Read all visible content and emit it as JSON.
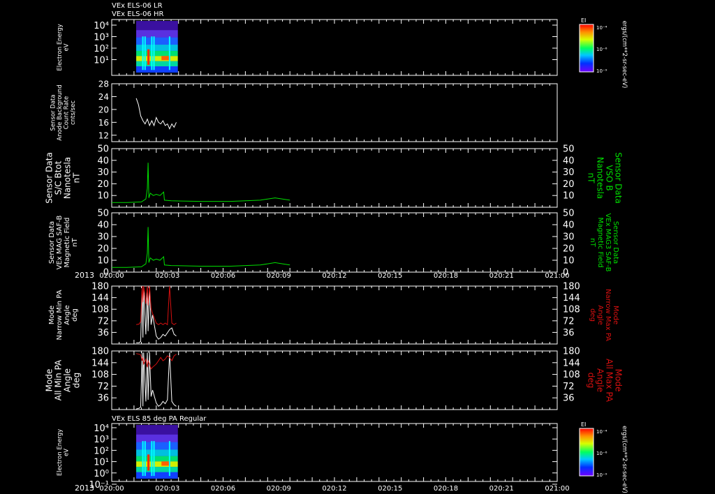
{
  "header": {
    "line1": "VEx ELS-06 LR",
    "line2": "VEx ELS-06 HR"
  },
  "time_axis": {
    "year": "2013",
    "tick_labels": [
      "020:00",
      "020:03",
      "020:06",
      "020:09",
      "020:12",
      "020:15",
      "020:18",
      "020:21",
      "021:00"
    ],
    "range_min": [
      0,
      64
    ]
  },
  "colors": {
    "white": "#ffffff",
    "green": "#00e000",
    "red": "#d81010",
    "background": "#000000"
  },
  "colorbar_units": "ergs/(cm**2-sr-sec-eV)",
  "chart_data": [
    {
      "id": "p1",
      "type": "heatmap",
      "ylabel": [
        "Electron Energy",
        "eV"
      ],
      "yscale": "log",
      "ytick_labels": [
        "10⁴",
        "10³",
        "10²",
        "10¹"
      ],
      "colorbar": {
        "label": "EI",
        "ticks": [
          "10⁻⁴",
          "10⁻⁶",
          "10⁻⁹"
        ]
      },
      "data_coverage_min": [
        3.3,
        8.9
      ]
    },
    {
      "id": "p2",
      "type": "line",
      "ylabel": [
        "Sensor Data",
        "Anode Background",
        "Count Rate",
        "cnts/sec"
      ],
      "ylim": [
        10,
        28
      ],
      "yticks": [
        12,
        16,
        20,
        24,
        28
      ],
      "series": [
        {
          "color": "#ffffff",
          "x": [
            3.3,
            3.6,
            3.9,
            4.2,
            4.5,
            4.8,
            5.1,
            5.4,
            5.7,
            6.0,
            6.3,
            6.6,
            6.9,
            7.2,
            7.5,
            7.8,
            8.1,
            8.4,
            8.7
          ],
          "values": [
            23.5,
            21.5,
            18,
            16.5,
            15.5,
            17,
            15,
            16.5,
            15,
            17.5,
            16,
            15.5,
            16.5,
            15,
            15.5,
            14,
            15.5,
            14.5,
            16
          ]
        }
      ]
    },
    {
      "id": "p3",
      "type": "line",
      "ylabel": [
        "Sensor Data",
        "S/C Btot",
        "Nanotesla",
        "nT"
      ],
      "right_label": [
        "Sensor Data",
        "VSO B",
        "Nanotesla",
        "nT"
      ],
      "ylim": [
        0,
        50
      ],
      "yticks": [
        10,
        20,
        30,
        40,
        50
      ],
      "series": [
        {
          "color": "#00e000",
          "x": [
            0,
            2,
            4,
            4.6,
            4.8,
            4.9,
            5.0,
            5.2,
            5.6,
            6.0,
            6.5,
            7.0,
            7.1,
            8,
            12,
            16,
            18,
            20,
            21,
            22,
            23,
            24
          ],
          "values": [
            4,
            4,
            4.5,
            7,
            16,
            38,
            8,
            12,
            10,
            11,
            10,
            13,
            6,
            5.5,
            5,
            5,
            5.5,
            6,
            7,
            8,
            7,
            6
          ]
        }
      ]
    },
    {
      "id": "p4",
      "type": "line",
      "ylabel": [
        "Sensor Data",
        "VEx MAG SAF-B",
        "Magnetic Field",
        "nT"
      ],
      "right_label": [
        "Sensor Data",
        "VEx MAG3 SAF-B",
        "Magnetic Field",
        "nT"
      ],
      "ylim": [
        0,
        50
      ],
      "yticks": [
        0,
        10,
        20,
        30,
        40,
        50
      ],
      "series": [
        {
          "color": "#00e000",
          "x": [
            0,
            2,
            4,
            4.6,
            4.8,
            4.9,
            5.0,
            5.2,
            5.6,
            6.0,
            6.5,
            7.0,
            7.1,
            8,
            12,
            16,
            18,
            20,
            21,
            22,
            23,
            24
          ],
          "values": [
            4,
            4,
            4.5,
            7,
            16,
            38,
            8,
            12,
            10,
            11,
            10,
            13,
            6,
            5.5,
            5,
            5,
            5.5,
            6,
            7,
            8,
            7,
            6
          ]
        }
      ]
    },
    {
      "id": "p5",
      "type": "line",
      "ylabel": [
        "Mode",
        "Narrow Min PA",
        "Angle",
        "deg"
      ],
      "right_label": [
        "Mode",
        "Narrow Max PA",
        "Angle",
        "deg"
      ],
      "ylim": [
        0,
        180
      ],
      "yticks": [
        36,
        72,
        108,
        144,
        180
      ],
      "series": [
        {
          "color": "#ffffff",
          "x": [
            3.3,
            3.7,
            3.9,
            4.1,
            4.2,
            4.3,
            4.6,
            4.8,
            4.9,
            5.1,
            5.3,
            5.5,
            6.0,
            6.3,
            6.6,
            6.9,
            7.2,
            7.5,
            7.8,
            8.1,
            8.4,
            8.7
          ],
          "values": [
            4,
            4,
            8,
            175,
            20,
            175,
            30,
            175,
            40,
            175,
            60,
            90,
            25,
            15,
            20,
            30,
            25,
            35,
            45,
            50,
            30,
            25
          ]
        },
        {
          "color": "#d81010",
          "x": [
            3.3,
            3.7,
            3.9,
            4.1,
            4.2,
            4.3,
            4.6,
            4.8,
            4.9,
            5.1,
            5.3,
            5.5,
            6.0,
            6.3,
            6.6,
            6.9,
            7.2,
            7.5,
            7.8,
            8.1,
            8.4,
            8.7
          ],
          "values": [
            60,
            62,
            70,
            180,
            130,
            180,
            125,
            180,
            120,
            180,
            110,
            95,
            65,
            60,
            65,
            60,
            65,
            60,
            180,
            65,
            60,
            65
          ]
        }
      ]
    },
    {
      "id": "p6",
      "type": "line",
      "ylabel": [
        "Mode",
        "All Min PA",
        "Angle",
        "deg"
      ],
      "right_label": [
        "Mode",
        "All Max PA",
        "Angle",
        "deg"
      ],
      "ylim": [
        0,
        180
      ],
      "yticks": [
        36,
        72,
        108,
        144,
        180
      ],
      "series": [
        {
          "color": "#ffffff",
          "x": [
            3.3,
            3.7,
            3.9,
            4.1,
            4.2,
            4.3,
            4.6,
            4.8,
            4.9,
            5.1,
            5.3,
            5.5,
            6.0,
            6.3,
            6.6,
            6.9,
            7.2,
            7.5,
            7.8,
            8.1,
            8.4,
            8.7
          ],
          "values": [
            2,
            4,
            8,
            175,
            10,
            175,
            25,
            175,
            30,
            175,
            40,
            60,
            20,
            10,
            15,
            25,
            18,
            30,
            175,
            25,
            15,
            10
          ]
        },
        {
          "color": "#d81010",
          "x": [
            3.3,
            3.7,
            3.9,
            4.1,
            4.2,
            4.3,
            4.6,
            4.8,
            4.9,
            5.1,
            5.3,
            5.5,
            6.0,
            6.3,
            6.6,
            6.9,
            7.2,
            7.5,
            7.8,
            8.1,
            8.4,
            8.7
          ],
          "values": [
            172,
            170,
            168,
            150,
            160,
            140,
            155,
            130,
            150,
            140,
            125,
            130,
            140,
            150,
            160,
            150,
            155,
            165,
            160,
            150,
            165,
            170
          ]
        }
      ]
    },
    {
      "id": "p7",
      "type": "heatmap",
      "title": "VEx ELS 85 deg PA Regular",
      "ylabel": [
        "Electron Energy",
        "eV"
      ],
      "yscale": "log",
      "ytick_labels": [
        "10⁴",
        "10³",
        "10²",
        "10¹",
        "10⁰",
        "10⁻¹"
      ],
      "colorbar": {
        "label": "EI",
        "ticks": [
          "10⁻⁴",
          "10⁻⁶",
          "10⁻⁹"
        ]
      },
      "data_coverage_min": [
        3.3,
        8.9
      ]
    }
  ]
}
